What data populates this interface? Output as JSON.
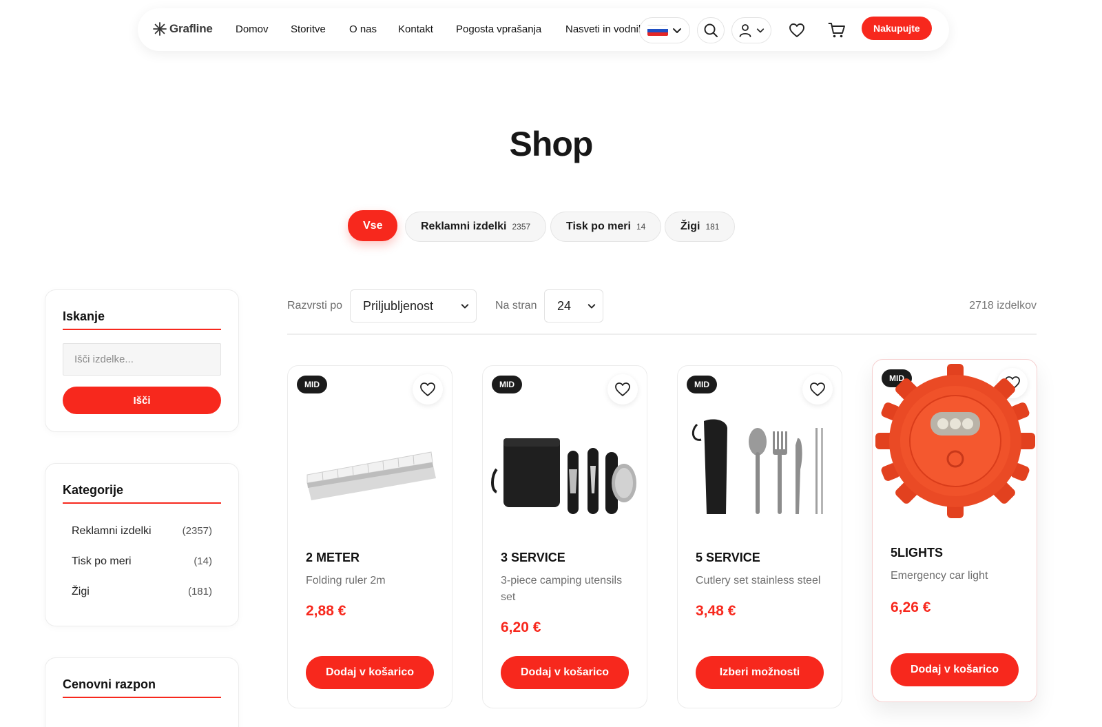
{
  "header": {
    "brand": "Grafline",
    "nav": [
      "Domov",
      "Storitve",
      "O nas",
      "Kontakt",
      "Pogosta vprašanja",
      "Nasveti in vodniki"
    ],
    "language_flag": "slovenia-flag",
    "icons": [
      "search-icon",
      "user-icon",
      "heart-icon",
      "cart-icon"
    ],
    "cta_label": "Nakupujte"
  },
  "page": {
    "title": "Shop"
  },
  "category_tabs": [
    {
      "label": "Vse",
      "count": ""
    },
    {
      "label": "Reklamni izdelki",
      "count": "2357"
    },
    {
      "label": "Tisk po meri",
      "count": "14"
    },
    {
      "label": "Žigi",
      "count": "181"
    }
  ],
  "sidebar": {
    "search": {
      "title": "Iskanje",
      "placeholder": "Išči izdelke...",
      "button_label": "Išči"
    },
    "categories": {
      "title": "Kategorije",
      "items": [
        {
          "label": "Reklamni izdelki",
          "count": "(2357)"
        },
        {
          "label": "Tisk po meri",
          "count": "(14)"
        },
        {
          "label": "Žigi",
          "count": "(181)"
        }
      ]
    },
    "price_range": {
      "title": "Cenovni razpon"
    }
  },
  "toolbar": {
    "sort_label": "Razvrsti po",
    "sort_value": "Priljubljenost",
    "per_page_label": "Na stran",
    "per_page_value": "24",
    "result_count": "2718 izdelkov"
  },
  "products": [
    {
      "badge": "MID",
      "name": "2 METER",
      "description": "Folding ruler 2m",
      "price": "2,88 €",
      "button": "Dodaj v košarico",
      "image": "folding-ruler"
    },
    {
      "badge": "MID",
      "name": "3 SERVICE",
      "description": "3-piece camping utensils set",
      "price": "6,20 €",
      "button": "Dodaj v košarico",
      "image": "camping-utensils"
    },
    {
      "badge": "MID",
      "name": "5 SERVICE",
      "description": "Cutlery set stainless steel",
      "price": "3,48 €",
      "button": "Izberi možnosti",
      "image": "cutlery-set"
    },
    {
      "badge": "MID",
      "name": "5LIGHTS",
      "description": "Emergency car light",
      "price": "6,26 €",
      "button": "Dodaj v košarico",
      "image": "emergency-light"
    }
  ],
  "colors": {
    "accent": "#f7281d",
    "text": "#1b1b1b",
    "muted": "#6e6e6e",
    "badge": "#1b1b1b"
  }
}
